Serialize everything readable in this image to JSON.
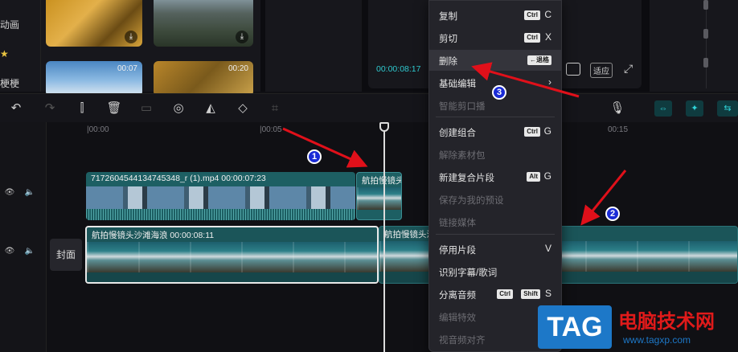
{
  "sidebar": {
    "items": [
      "动画",
      "★",
      "梗梗"
    ]
  },
  "media": {
    "thumbs": [
      {
        "duration": "",
        "download": "⤓"
      },
      {
        "duration": "",
        "download": "⤓"
      },
      {
        "duration": "00:07",
        "download": ""
      },
      {
        "duration": "00:20",
        "download": ""
      }
    ]
  },
  "player": {
    "time": "00:00:08:17",
    "fit_label": "适应"
  },
  "ruler": {
    "ticks": [
      "|00:00",
      "|00:05",
      "00:15"
    ]
  },
  "tracks": {
    "cover_label": "封面",
    "clip1_label": "7172604544134745348_r (1).mp4  00:00:07:23",
    "clip1b_label": "航拍慢镜头",
    "clip2_label": "航拍慢镜头沙滩海浪  00:00:08:11",
    "clip2b_label": "航拍慢镜头沙"
  },
  "context_menu": {
    "items": [
      {
        "label": "复制",
        "keys": [
          "Ctrl"
        ],
        "key": "C",
        "enabled": true
      },
      {
        "label": "剪切",
        "keys": [
          "Ctrl"
        ],
        "key": "X",
        "enabled": true
      },
      {
        "label": "删除",
        "keys": [
          "←退格"
        ],
        "key": "",
        "enabled": true
      },
      {
        "label": "基础编辑",
        "keys": [],
        "key": "›",
        "enabled": true
      },
      {
        "label": "智能剪口播",
        "keys": [],
        "key": "",
        "enabled": false
      },
      {
        "label": "创建组合",
        "keys": [
          "Ctrl"
        ],
        "key": "G",
        "enabled": true
      },
      {
        "label": "解除素材包",
        "keys": [],
        "key": "",
        "enabled": false
      },
      {
        "label": "新建复合片段",
        "keys": [
          "Alt"
        ],
        "key": "G",
        "enabled": true
      },
      {
        "label": "保存为我的预设",
        "keys": [],
        "key": "",
        "enabled": false
      },
      {
        "label": "链接媒体",
        "keys": [],
        "key": "",
        "enabled": false
      },
      {
        "label": "停用片段",
        "keys": [],
        "key": "V",
        "enabled": true
      },
      {
        "label": "识别字幕/歌词",
        "keys": [],
        "key": "",
        "enabled": true
      },
      {
        "label": "分离音频",
        "keys": [
          "Ctrl",
          "Shift"
        ],
        "key": "S",
        "enabled": true
      },
      {
        "label": "编辑特效",
        "keys": [],
        "key": "",
        "enabled": false
      },
      {
        "label": "视音频对齐",
        "keys": [],
        "key": "",
        "enabled": false
      }
    ]
  },
  "annotations": {
    "badges": [
      "1",
      "2",
      "3"
    ],
    "arrow_color": "#e0101a",
    "badge_color": "#1a2bd6"
  },
  "watermark": {
    "logo": "TAG",
    "title": "电脑技术网",
    "url": "www.tagxp.com"
  }
}
